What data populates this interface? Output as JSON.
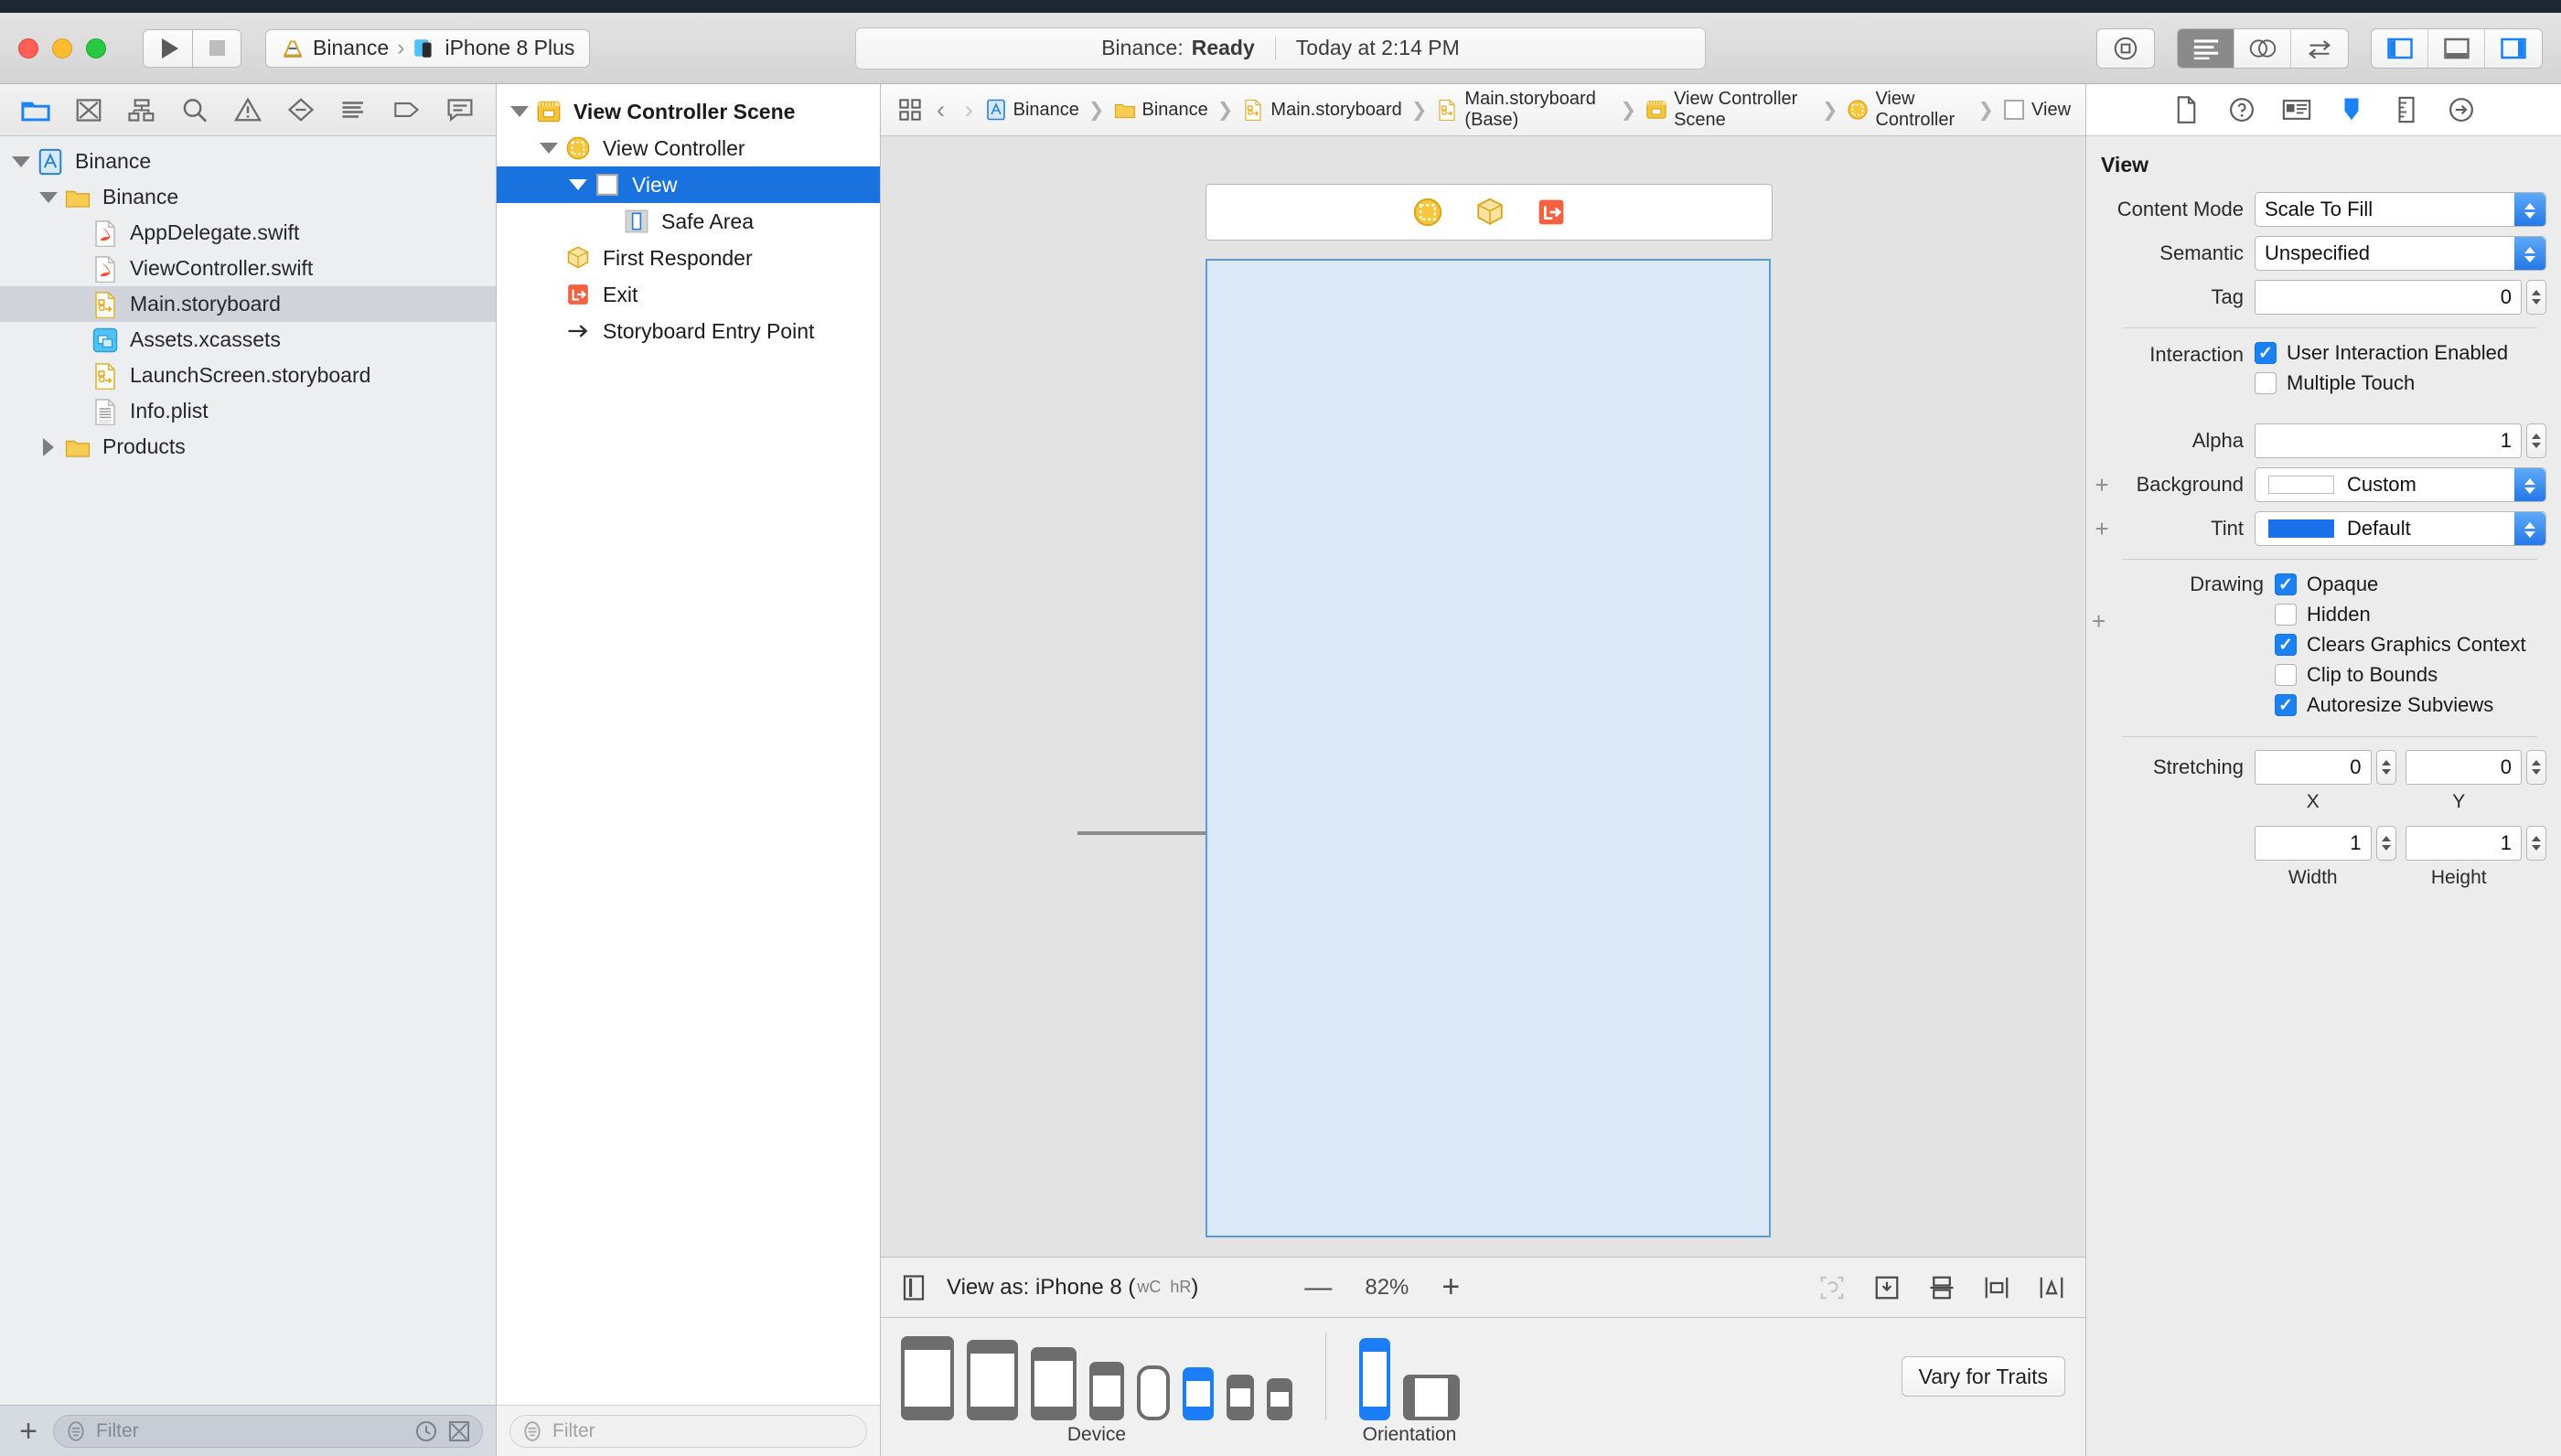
{
  "toolbar": {
    "run_label": "Run",
    "stop_label": "Stop",
    "scheme_project": "Binance",
    "scheme_separator": "›",
    "scheme_device": "iPhone 8 Plus",
    "status_prefix": "Binance:",
    "status_state": "Ready",
    "status_time": "Today at 2:14 PM"
  },
  "navigator": {
    "tabs": [
      "folder-icon",
      "xmark-box-icon",
      "hierarchy-icon",
      "search-icon",
      "warning-icon",
      "debug-icon",
      "report-icon",
      "tag-icon",
      "comment-icon"
    ],
    "items": [
      {
        "label": "Binance",
        "indent": 0,
        "icon": "xcode-project-icon",
        "twisty": "down",
        "selected": false
      },
      {
        "label": "Binance",
        "indent": 1,
        "icon": "folder-yellow-icon",
        "twisty": "down",
        "selected": false
      },
      {
        "label": "AppDelegate.swift",
        "indent": 2,
        "icon": "swift-file-icon",
        "twisty": "none",
        "selected": false
      },
      {
        "label": "ViewController.swift",
        "indent": 2,
        "icon": "swift-file-icon",
        "twisty": "none",
        "selected": false
      },
      {
        "label": "Main.storyboard",
        "indent": 2,
        "icon": "storyboard-icon",
        "twisty": "none",
        "selected": true
      },
      {
        "label": "Assets.xcassets",
        "indent": 2,
        "icon": "assets-icon",
        "twisty": "none",
        "selected": false
      },
      {
        "label": "LaunchScreen.storyboard",
        "indent": 2,
        "icon": "storyboard-icon",
        "twisty": "none",
        "selected": false
      },
      {
        "label": "Info.plist",
        "indent": 2,
        "icon": "plist-icon",
        "twisty": "none",
        "selected": false
      },
      {
        "label": "Products",
        "indent": 1,
        "icon": "folder-yellow-icon",
        "twisty": "right",
        "selected": false
      }
    ],
    "filter_placeholder": "Filter"
  },
  "outline": {
    "items": [
      {
        "label": "View Controller Scene",
        "indent": 0,
        "icon": "scene-icon",
        "twisty": "down",
        "selected": false,
        "bold": true
      },
      {
        "label": "View Controller",
        "indent": 1,
        "icon": "view-controller-icon",
        "twisty": "down",
        "selected": false,
        "bold": false
      },
      {
        "label": "View",
        "indent": 2,
        "icon": "view-icon",
        "twisty": "down",
        "selected": true,
        "bold": false
      },
      {
        "label": "Safe Area",
        "indent": 3,
        "icon": "safe-area-icon",
        "twisty": "none",
        "selected": false,
        "bold": false
      },
      {
        "label": "First Responder",
        "indent": 1,
        "icon": "first-responder-icon",
        "twisty": "none",
        "selected": false,
        "bold": false
      },
      {
        "label": "Exit",
        "indent": 1,
        "icon": "exit-icon",
        "twisty": "none",
        "selected": false,
        "bold": false
      },
      {
        "label": "Storyboard Entry Point",
        "indent": 1,
        "icon": "entry-point-icon",
        "twisty": "none",
        "selected": false,
        "bold": false
      }
    ],
    "filter_placeholder": "Filter"
  },
  "jumpbar": {
    "crumbs": [
      {
        "label": "Binance",
        "icon": "xcode-project-icon"
      },
      {
        "label": "Binance",
        "icon": "folder-yellow-icon"
      },
      {
        "label": "Main.storyboard",
        "icon": "storyboard-icon"
      },
      {
        "label": "Main.storyboard (Base)",
        "icon": "storyboard-icon"
      },
      {
        "label": "View Controller Scene",
        "icon": "scene-icon"
      },
      {
        "label": "View Controller",
        "icon": "view-controller-icon"
      },
      {
        "label": "View",
        "icon": "view-icon"
      }
    ]
  },
  "canvas": {
    "view_as_label": "View as: iPhone 8 (",
    "view_as_wc": "wC",
    "view_as_hr": "hR",
    "view_as_close": ")",
    "zoom_out": "—",
    "zoom_level": "82%",
    "zoom_in": "+",
    "scene_bar_icons": [
      "view-controller-icon",
      "first-responder-icon",
      "exit-icon"
    ],
    "selection_color": "#5a9bd8",
    "view_fill_color": "#dce9f7"
  },
  "devicebar": {
    "device_label": "Device",
    "orientation_label": "Orientation",
    "vary_label": "Vary for Traits",
    "selected_device_index": 5,
    "selected_orientation_index": 0,
    "accent_color": "#1b7ef7"
  },
  "inspector": {
    "tabs": [
      "file-inspector-icon",
      "quick-help-icon",
      "identity-inspector-icon",
      "attributes-inspector-icon",
      "size-inspector-icon",
      "connections-inspector-icon"
    ],
    "active_tab_index": 3,
    "section_title": "View",
    "content_mode_label": "Content Mode",
    "content_mode_value": "Scale To Fill",
    "semantic_label": "Semantic",
    "semantic_value": "Unspecified",
    "tag_label": "Tag",
    "tag_value": "0",
    "interaction_label": "Interaction",
    "user_interaction_label": "User Interaction Enabled",
    "user_interaction_checked": true,
    "multiple_touch_label": "Multiple Touch",
    "multiple_touch_checked": false,
    "alpha_label": "Alpha",
    "alpha_value": "1",
    "background_label": "Background",
    "background_value": "Custom",
    "background_swatch": "#ffffff",
    "tint_label": "Tint",
    "tint_value": "Default",
    "tint_swatch": "#1b72e8",
    "drawing_label": "Drawing",
    "opaque_label": "Opaque",
    "opaque_checked": true,
    "hidden_label": "Hidden",
    "hidden_checked": false,
    "clears_label": "Clears Graphics Context",
    "clears_checked": true,
    "clip_label": "Clip to Bounds",
    "clip_checked": false,
    "autoresize_label": "Autoresize Subviews",
    "autoresize_checked": true,
    "stretching_label": "Stretching",
    "stretch_x": "0",
    "stretch_y": "0",
    "stretch_w": "1",
    "stretch_h": "1",
    "stretch_x_label": "X",
    "stretch_y_label": "Y",
    "stretch_w_label": "Width",
    "stretch_h_label": "Height"
  }
}
